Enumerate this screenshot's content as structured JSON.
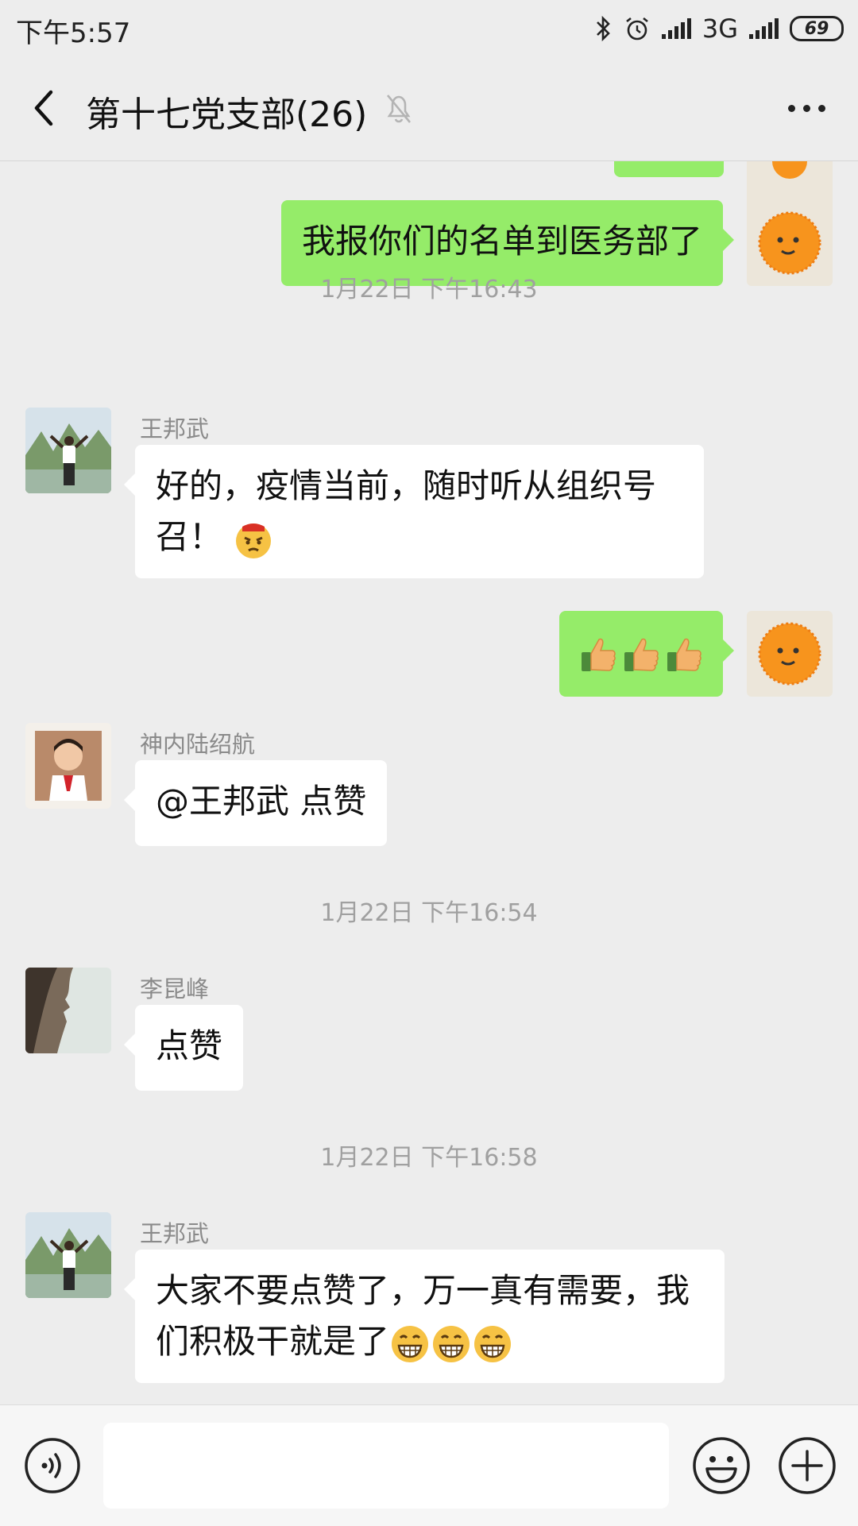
{
  "status_bar": {
    "time": "下午5:57",
    "network": "3G",
    "battery": "69",
    "icons": [
      "bluetooth-icon",
      "alarm-icon",
      "signal-icon",
      "signal-icon"
    ]
  },
  "header": {
    "title": "第十七党支部(26)",
    "icons": [
      "back-icon",
      "mute-bell-icon",
      "more-icon"
    ]
  },
  "messages": [
    {
      "type": "outgoing",
      "text": "我报你们的名单到医务部了"
    },
    {
      "type": "timestamp",
      "text": "1月22日 下午16:43"
    },
    {
      "type": "incoming",
      "sender": "王邦武",
      "text": "好的，疫情当前，随时听从组织号召！",
      "emoji": "angry-face-emoji"
    },
    {
      "type": "outgoing",
      "text": "",
      "emoji": "thumbs-up-emoji x3"
    },
    {
      "type": "incoming",
      "sender": "神内陆绍航",
      "text": "@王邦武  点赞"
    },
    {
      "type": "timestamp",
      "text": "1月22日 下午16:54"
    },
    {
      "type": "incoming",
      "sender": "李昆峰",
      "text": "点赞"
    },
    {
      "type": "timestamp",
      "text": "1月22日 下午16:58"
    },
    {
      "type": "incoming",
      "sender": "王邦武",
      "text": "大家不要点赞了，万一真有需要，我们积极干就是了",
      "emoji": "grinning-face-emoji x3"
    }
  ],
  "input_bar": {
    "placeholder": "",
    "icons": [
      "voice-icon",
      "emoji-icon",
      "plus-icon"
    ]
  },
  "colors": {
    "background": "#ededed",
    "outgoing_bubble": "#95ec69",
    "incoming_bubble": "#ffffff",
    "timestamp_text": "#a0a0a0",
    "sender_text": "#8a8a8a"
  }
}
